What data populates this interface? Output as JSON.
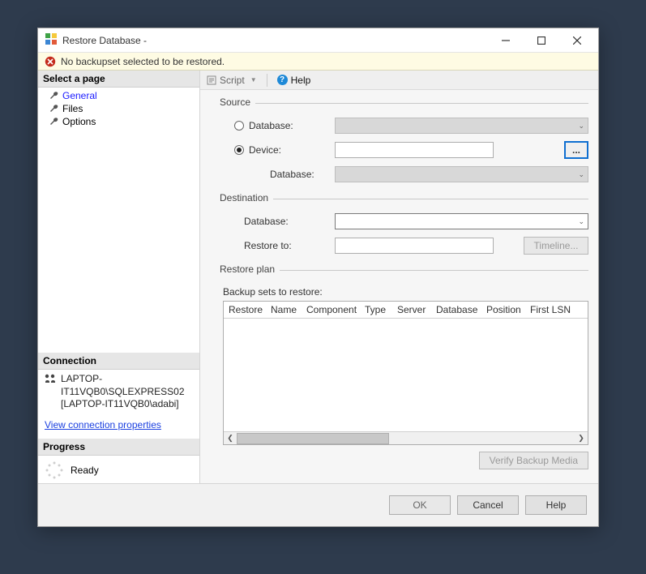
{
  "window": {
    "title": "Restore Database -"
  },
  "warning": {
    "text": "No backupset selected to be restored."
  },
  "sidebar": {
    "select_page": "Select a page",
    "pages": [
      "General",
      "Files",
      "Options"
    ],
    "connection_header": "Connection",
    "connection_line1": "LAPTOP-IT11VQB0\\SQLEXPRESS02 [LAPTOP-IT11VQB0\\adabi]",
    "view_conn_link": "View connection properties",
    "progress_header": "Progress",
    "progress_text": "Ready"
  },
  "toolstrip": {
    "script": "Script",
    "help": "Help"
  },
  "form": {
    "source_label": "Source",
    "source_database_label": "Database:",
    "source_database_value": "",
    "source_device_label": "Device:",
    "source_device_value": "",
    "source_db2_label": "Database:",
    "source_db2_value": "",
    "destination_label": "Destination",
    "dest_database_label": "Database:",
    "dest_database_value": "",
    "restore_to_label": "Restore to:",
    "restore_to_value": "",
    "timeline_btn": "Timeline...",
    "restore_plan_label": "Restore plan",
    "backup_sets_label": "Backup sets to restore:",
    "columns": [
      "Restore",
      "Name",
      "Component",
      "Type",
      "Server",
      "Database",
      "Position",
      "First LSN"
    ],
    "ellipsis": "...",
    "verify_btn": "Verify Backup Media"
  },
  "footer": {
    "ok": "OK",
    "cancel": "Cancel",
    "help": "Help"
  }
}
